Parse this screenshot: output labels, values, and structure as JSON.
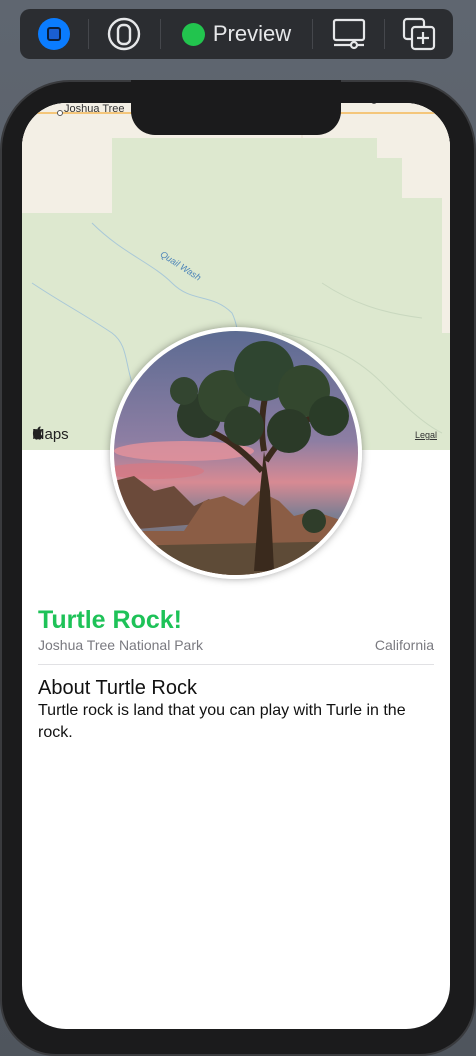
{
  "toolbar": {
    "preview_label": "Preview",
    "preview_dot_color": "#22c44e",
    "live_button_color": "#0a7cff"
  },
  "map": {
    "town_label": "Joshua Tree",
    "wash_label": "Quail Wash",
    "maps_brand": "Maps",
    "legal_label": "Legal"
  },
  "landmark": {
    "name": "Turtle Rock!",
    "park": "Joshua Tree National Park",
    "state": "California",
    "about_heading": "About Turtle Rock",
    "about_text": "Turtle rock is land that you can play with Turle in the rock.",
    "title_color": "#1ec258"
  }
}
